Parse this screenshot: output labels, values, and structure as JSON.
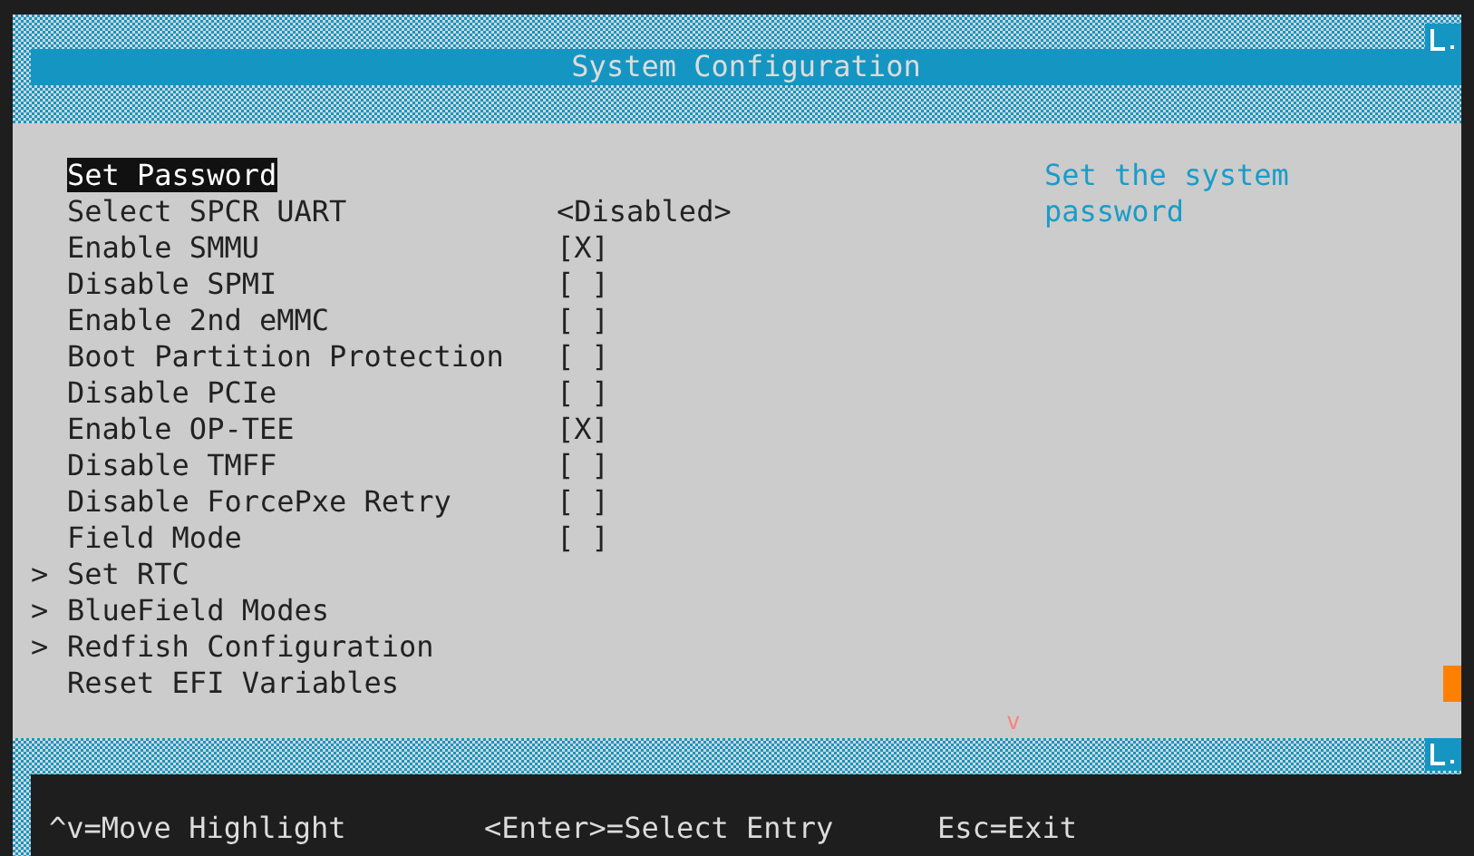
{
  "title": "System Configuration",
  "items": [
    {
      "kind": "action",
      "label": "Set Password",
      "selected": true
    },
    {
      "kind": "option",
      "label": "Select SPCR UART",
      "value": "<Disabled>",
      "selected": false
    },
    {
      "kind": "option",
      "label": "Enable SMMU",
      "value": "[X]",
      "selected": false
    },
    {
      "kind": "option",
      "label": "Disable SPMI",
      "value": "[ ]",
      "selected": false
    },
    {
      "kind": "option",
      "label": "Enable 2nd eMMC",
      "value": "[ ]",
      "selected": false
    },
    {
      "kind": "option",
      "label": "Boot Partition Protection",
      "value": "[ ]",
      "selected": false
    },
    {
      "kind": "option",
      "label": "Disable PCIe",
      "value": "[ ]",
      "selected": false
    },
    {
      "kind": "option",
      "label": "Enable OP-TEE",
      "value": "[X]",
      "selected": false
    },
    {
      "kind": "option",
      "label": "Disable TMFF",
      "value": "[ ]",
      "selected": false
    },
    {
      "kind": "option",
      "label": "Disable ForcePxe Retry",
      "value": "[ ]",
      "selected": false
    },
    {
      "kind": "option",
      "label": "Field Mode",
      "value": "[ ]",
      "selected": false
    },
    {
      "kind": "submenu",
      "marker": ">",
      "label": "Set RTC",
      "selected": false
    },
    {
      "kind": "submenu",
      "marker": ">",
      "label": "BlueField Modes",
      "selected": false
    },
    {
      "kind": "submenu",
      "marker": ">",
      "label": "Redfish Configuration",
      "selected": false
    },
    {
      "kind": "action",
      "label": "Reset EFI Variables",
      "selected": false
    }
  ],
  "help": "Set the system password",
  "scroll_indicator": "v",
  "hints": [
    "^v=Move Highlight",
    "<Enter>=Select Entry",
    "Esc=Exit"
  ]
}
